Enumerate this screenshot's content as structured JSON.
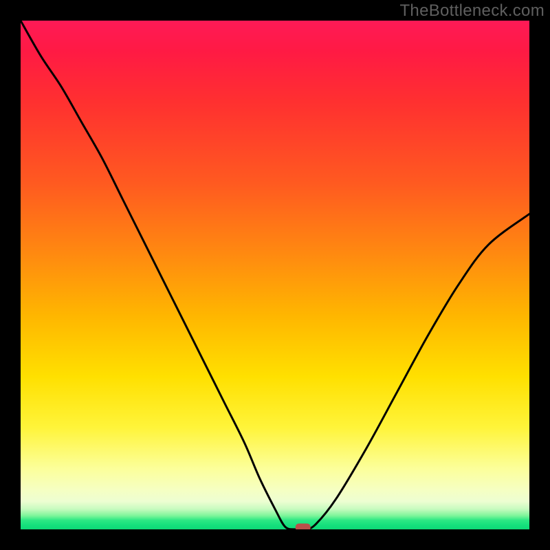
{
  "watermark": "TheBottleneck.com",
  "chart_data": {
    "type": "line",
    "title": "",
    "xlabel": "",
    "ylabel": "",
    "xlim": [
      0,
      1
    ],
    "ylim": [
      0,
      1
    ],
    "series": [
      {
        "name": "bottleneck-curve",
        "x": [
          0.0,
          0.04,
          0.08,
          0.12,
          0.16,
          0.2,
          0.24,
          0.28,
          0.32,
          0.36,
          0.4,
          0.44,
          0.47,
          0.5,
          0.52,
          0.54,
          0.56,
          0.58,
          0.62,
          0.68,
          0.74,
          0.8,
          0.86,
          0.92,
          1.0
        ],
        "y": [
          1.0,
          0.93,
          0.87,
          0.8,
          0.73,
          0.65,
          0.57,
          0.49,
          0.41,
          0.33,
          0.25,
          0.17,
          0.1,
          0.04,
          0.005,
          0.0,
          0.0,
          0.01,
          0.06,
          0.16,
          0.27,
          0.38,
          0.48,
          0.56,
          0.62
        ]
      }
    ],
    "annotations": [
      {
        "name": "min-marker",
        "x": 0.555,
        "y": 0.0,
        "shape": "pill",
        "color": "#bb4f4a"
      }
    ],
    "background_gradient_stops": [
      {
        "pos": 0.0,
        "color": "#ff1a56"
      },
      {
        "pos": 0.16,
        "color": "#ff3030"
      },
      {
        "pos": 0.46,
        "color": "#ff8a10"
      },
      {
        "pos": 0.7,
        "color": "#ffe000"
      },
      {
        "pos": 0.92,
        "color": "#f6ffc0"
      },
      {
        "pos": 0.98,
        "color": "#2de884"
      },
      {
        "pos": 1.0,
        "color": "#0fd877"
      }
    ]
  }
}
